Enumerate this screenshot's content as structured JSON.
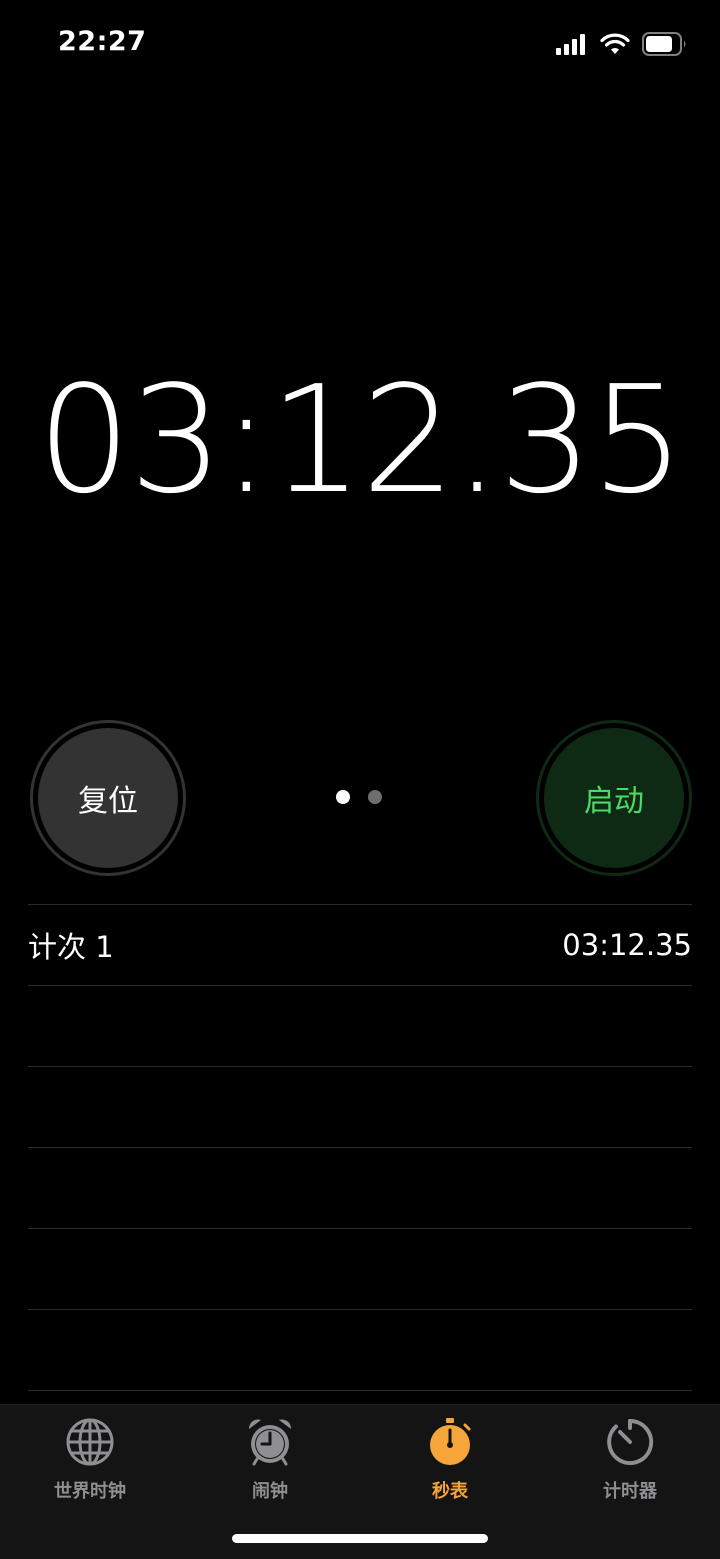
{
  "status_bar": {
    "time": "22:27"
  },
  "stopwatch": {
    "display": "03:12.35"
  },
  "buttons": {
    "reset_label": "复位",
    "start_label": "启动"
  },
  "pager": {
    "page_count": 2,
    "active_index": 0
  },
  "laps": [
    {
      "label": "计次 1",
      "time": "03:12.35"
    }
  ],
  "tabs": [
    {
      "label": "世界时钟",
      "icon": "globe-icon",
      "active": false
    },
    {
      "label": "闹钟",
      "icon": "alarm-clock-icon",
      "active": false
    },
    {
      "label": "秒表",
      "icon": "stopwatch-icon",
      "active": true
    },
    {
      "label": "计时器",
      "icon": "timer-icon",
      "active": false
    }
  ],
  "colors": {
    "background": "#000000",
    "start_text": "#4cd964",
    "start_bg": "#0e2a14",
    "reset_bg": "#333333",
    "tab_active": "#f6a53a",
    "tab_inactive": "#8e8e93"
  }
}
